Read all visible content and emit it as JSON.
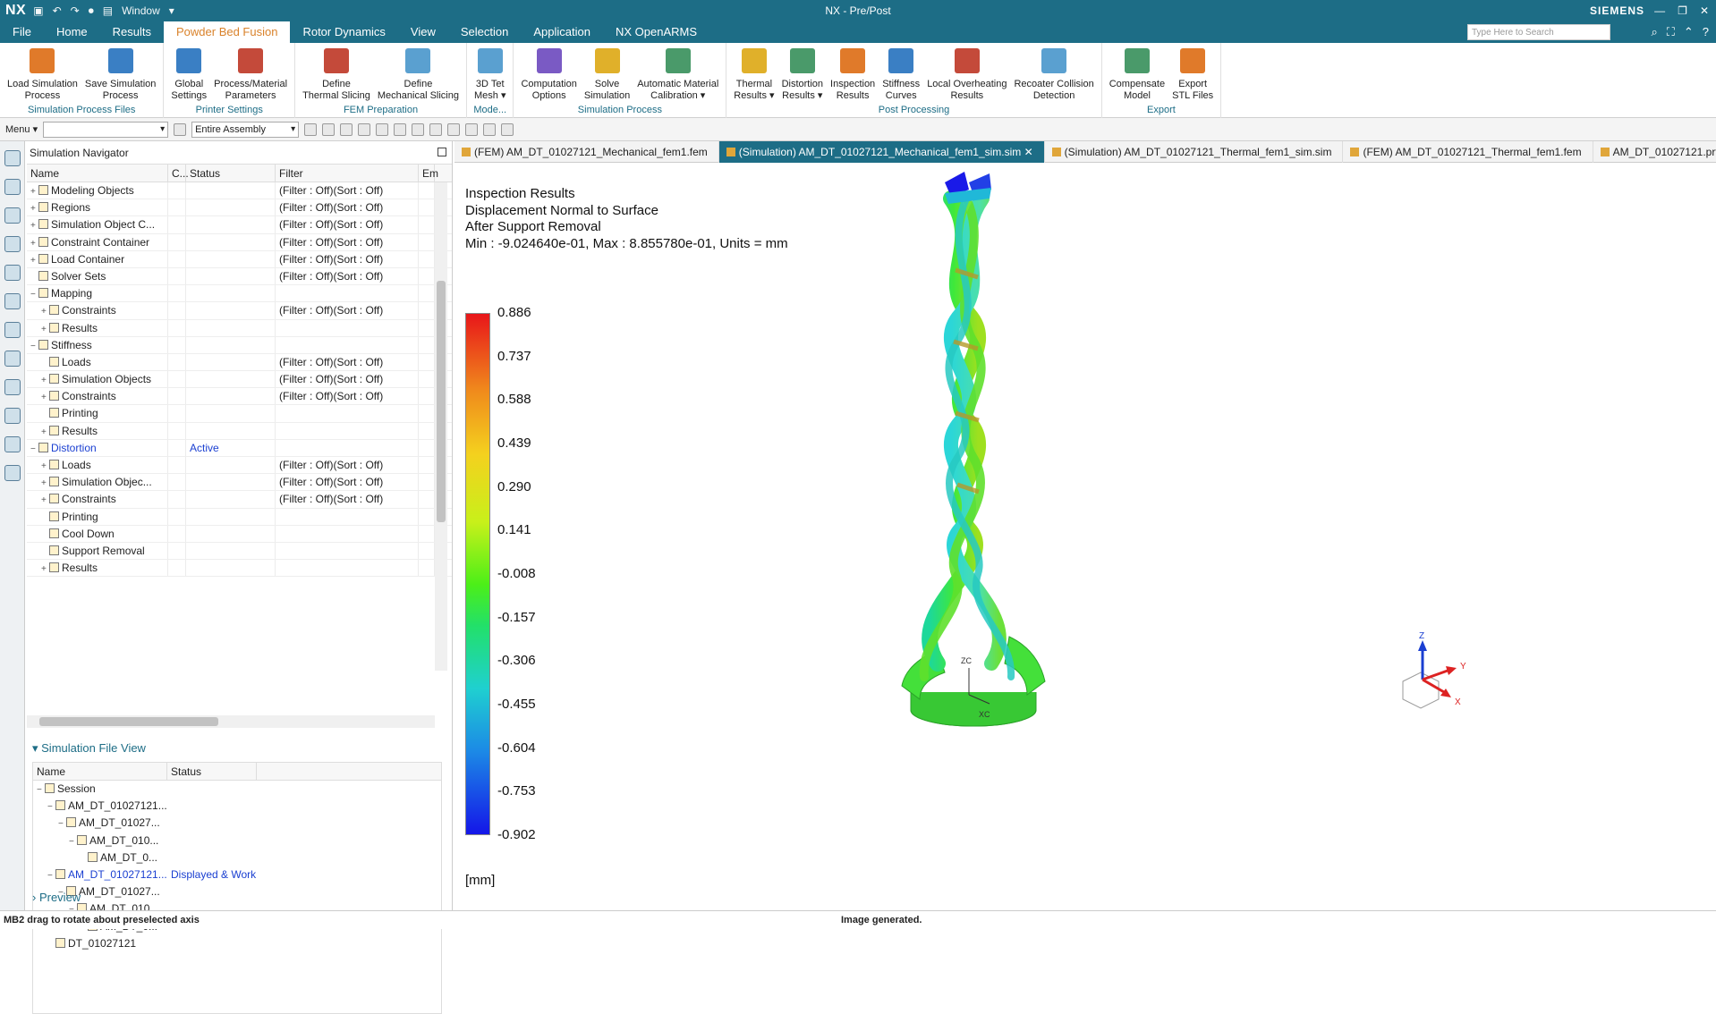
{
  "titlebar": {
    "logo": "NX",
    "window_menu": "Window",
    "title": "NX - Pre/Post",
    "brand": "SIEMENS"
  },
  "menubar": {
    "tabs": [
      "File",
      "Home",
      "Results",
      "Powder Bed Fusion",
      "Rotor Dynamics",
      "View",
      "Selection",
      "Application",
      "NX OpenARMS"
    ],
    "active_tab": "Powder Bed Fusion",
    "search_placeholder": "Type Here to Search"
  },
  "ribbon": {
    "groups": [
      {
        "label": "Simulation Process Files",
        "buttons": [
          [
            "Load Simulation",
            "Process"
          ],
          [
            "Save Simulation",
            "Process"
          ]
        ]
      },
      {
        "label": "Printer Settings",
        "buttons": [
          [
            "Global",
            "Settings"
          ],
          [
            "Process/Material",
            "Parameters"
          ]
        ]
      },
      {
        "label": "FEM Preparation",
        "buttons": [
          [
            "Define",
            "Thermal Slicing"
          ],
          [
            "Define",
            "Mechanical Slicing"
          ]
        ]
      },
      {
        "label": "Mode...",
        "buttons": [
          [
            "3D Tet",
            "Mesh ▾"
          ]
        ]
      },
      {
        "label": "Simulation Process",
        "buttons": [
          [
            "Computation",
            "Options"
          ],
          [
            "Solve",
            "Simulation"
          ],
          [
            "Automatic Material",
            "Calibration ▾"
          ]
        ]
      },
      {
        "label": "Post Processing",
        "buttons": [
          [
            "Thermal",
            "Results ▾"
          ],
          [
            "Distortion",
            "Results ▾"
          ],
          [
            "Inspection",
            "Results"
          ],
          [
            "Stiffness",
            "Curves"
          ],
          [
            "Local Overheating",
            "Results"
          ],
          [
            "Recoater Collision",
            "Detection"
          ]
        ]
      },
      {
        "label": "Export",
        "buttons": [
          [
            "Compensate",
            "Model"
          ],
          [
            "Export",
            "STL Files"
          ]
        ]
      }
    ]
  },
  "toolbar": {
    "menu_label": "Menu ▾",
    "assembly_value": "Entire Assembly"
  },
  "navigator": {
    "title": "Simulation Navigator",
    "columns": [
      "Name",
      "C...",
      "Status",
      "Filter",
      "Em"
    ],
    "rows": [
      {
        "indent": 0,
        "exp": "+",
        "name": "Modeling Objects",
        "status": "",
        "filter": "(Filter : Off)(Sort : Off)"
      },
      {
        "indent": 0,
        "exp": "+",
        "name": "Regions",
        "status": "",
        "filter": "(Filter : Off)(Sort : Off)"
      },
      {
        "indent": 0,
        "exp": "+",
        "name": "Simulation Object C...",
        "status": "",
        "filter": "(Filter : Off)(Sort : Off)"
      },
      {
        "indent": 0,
        "exp": "+",
        "name": "Constraint Container",
        "status": "",
        "filter": "(Filter : Off)(Sort : Off)"
      },
      {
        "indent": 0,
        "exp": "+",
        "name": "Load Container",
        "status": "",
        "filter": "(Filter : Off)(Sort : Off)"
      },
      {
        "indent": 0,
        "exp": "",
        "name": "Solver Sets",
        "status": "",
        "filter": "(Filter : Off)(Sort : Off)"
      },
      {
        "indent": 0,
        "exp": "−",
        "name": "Mapping",
        "status": "",
        "filter": ""
      },
      {
        "indent": 1,
        "exp": "+",
        "name": "Constraints",
        "status": "",
        "filter": "(Filter : Off)(Sort : Off)"
      },
      {
        "indent": 1,
        "exp": "+",
        "name": "Results",
        "status": "",
        "filter": ""
      },
      {
        "indent": 0,
        "exp": "−",
        "name": "Stiffness",
        "status": "",
        "filter": ""
      },
      {
        "indent": 1,
        "exp": "",
        "name": "Loads",
        "status": "",
        "filter": "(Filter : Off)(Sort : Off)"
      },
      {
        "indent": 1,
        "exp": "+",
        "name": "Simulation Objects",
        "status": "",
        "filter": "(Filter : Off)(Sort : Off)"
      },
      {
        "indent": 1,
        "exp": "+",
        "name": "Constraints",
        "status": "",
        "filter": "(Filter : Off)(Sort : Off)"
      },
      {
        "indent": 1,
        "exp": "",
        "name": "Printing",
        "status": "",
        "filter": ""
      },
      {
        "indent": 1,
        "exp": "+",
        "name": "Results",
        "status": "",
        "filter": ""
      },
      {
        "indent": 0,
        "exp": "−",
        "name": "Distortion",
        "status": "Active",
        "filter": "",
        "active": true
      },
      {
        "indent": 1,
        "exp": "+",
        "name": "Loads",
        "status": "",
        "filter": "(Filter : Off)(Sort : Off)"
      },
      {
        "indent": 1,
        "exp": "+",
        "name": "Simulation Objec...",
        "status": "",
        "filter": "(Filter : Off)(Sort : Off)"
      },
      {
        "indent": 1,
        "exp": "+",
        "name": "Constraints",
        "status": "",
        "filter": "(Filter : Off)(Sort : Off)"
      },
      {
        "indent": 1,
        "exp": "",
        "name": "Printing",
        "status": "",
        "filter": ""
      },
      {
        "indent": 1,
        "exp": "",
        "name": "Cool Down",
        "status": "",
        "filter": ""
      },
      {
        "indent": 1,
        "exp": "",
        "name": "Support Removal",
        "status": "",
        "filter": ""
      },
      {
        "indent": 1,
        "exp": "+",
        "name": "Results",
        "status": "",
        "filter": ""
      }
    ]
  },
  "file_view": {
    "title": "Simulation File View",
    "columns": [
      "Name",
      "Status"
    ],
    "rows": [
      {
        "indent": 0,
        "exp": "−",
        "name": "Session",
        "status": ""
      },
      {
        "indent": 1,
        "exp": "−",
        "name": "AM_DT_01027121...",
        "status": ""
      },
      {
        "indent": 2,
        "exp": "−",
        "name": "AM_DT_01027...",
        "status": ""
      },
      {
        "indent": 3,
        "exp": "−",
        "name": "AM_DT_010...",
        "status": ""
      },
      {
        "indent": 4,
        "exp": "",
        "name": "AM_DT_0...",
        "status": ""
      },
      {
        "indent": 1,
        "exp": "−",
        "name": "AM_DT_01027121...",
        "status": "Displayed & Work",
        "active": true
      },
      {
        "indent": 2,
        "exp": "−",
        "name": "AM_DT_01027...",
        "status": ""
      },
      {
        "indent": 3,
        "exp": "−",
        "name": "AM_DT_010...",
        "status": ""
      },
      {
        "indent": 4,
        "exp": "",
        "name": "AM_DT_0...",
        "status": ""
      },
      {
        "indent": 1,
        "exp": "",
        "name": "DT_01027121",
        "status": ""
      }
    ],
    "preview_label": "Preview"
  },
  "file_tabs": [
    {
      "label": "(FEM) AM_DT_01027121_Mechanical_fem1.fem",
      "active": false
    },
    {
      "label": "(Simulation) AM_DT_01027121_Mechanical_fem1_sim.sim",
      "active": true
    },
    {
      "label": "(Simulation) AM_DT_01027121_Thermal_fem1_sim.sim",
      "active": false
    },
    {
      "label": "(FEM) AM_DT_01027121_Thermal_fem1.fem",
      "active": false
    },
    {
      "label": "AM_DT_01027121.prt",
      "active": false
    }
  ],
  "viewport": {
    "result_lines": [
      "Inspection Results",
      "Displacement Normal to Surface",
      "After Support Removal",
      "Min : -9.024640e-01, Max : 8.855780e-01, Units = mm"
    ],
    "legend_values": [
      "0.886",
      "0.737",
      "0.588",
      "0.439",
      "0.290",
      "0.141",
      "-0.008",
      "-0.157",
      "-0.306",
      "-0.455",
      "-0.604",
      "-0.753",
      "-0.902"
    ],
    "units_label": "[mm]",
    "triad": {
      "z": "Z",
      "y": "Y",
      "x": "X"
    },
    "wcs": {
      "zc": "ZC",
      "xc": "XC"
    }
  },
  "status": {
    "left": "MB2 drag to rotate about preselected axis",
    "center": "Image generated."
  }
}
